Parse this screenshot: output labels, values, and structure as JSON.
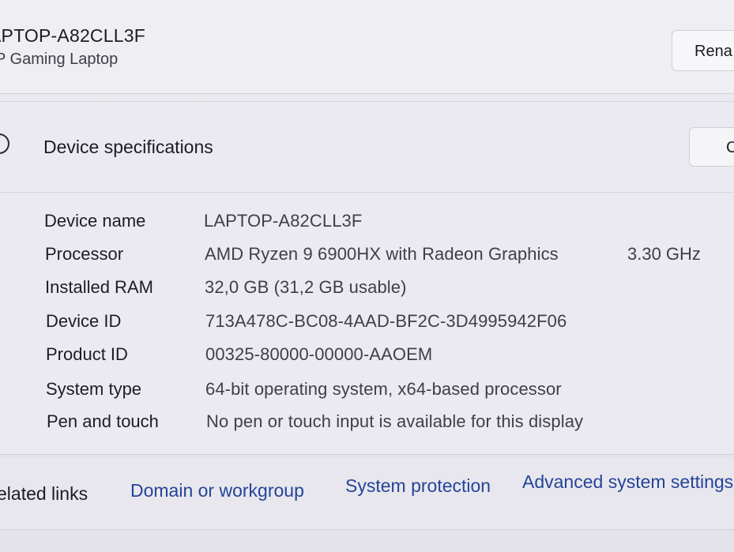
{
  "header": {
    "device_title": "APTOP-A82CLL3F",
    "device_model": "P Gaming Laptop",
    "rename_label": "Rena"
  },
  "spec_section": {
    "title": "Device specifications",
    "copy_label": "C",
    "icon": "info-icon",
    "rows": [
      {
        "label": "Device name",
        "value": "LAPTOP-A82CLL3F",
        "extra": ""
      },
      {
        "label": "Processor",
        "value": "AMD Ryzen 9 6900HX with Radeon Graphics",
        "extra": "3.30 GHz"
      },
      {
        "label": "Installed RAM",
        "value": "32,0 GB (31,2 GB usable)",
        "extra": ""
      },
      {
        "label": "Device ID",
        "value": "713A478C-BC08-4AAD-BF2C-3D4995942F06",
        "extra": ""
      },
      {
        "label": "Product ID",
        "value": "00325-80000-00000-AAOEM",
        "extra": ""
      },
      {
        "label": "System type",
        "value": "64-bit operating system, x64-based processor",
        "extra": ""
      },
      {
        "label": "Pen and touch",
        "value": "No pen or touch input is available for this display",
        "extra": ""
      }
    ]
  },
  "related": {
    "label": "elated links",
    "links": [
      {
        "label": "Domain or workgroup"
      },
      {
        "label": "System protection"
      },
      {
        "label": "Advanced system settings"
      }
    ]
  },
  "colors": {
    "link": "#24449a",
    "background": "#e9e8ee"
  }
}
